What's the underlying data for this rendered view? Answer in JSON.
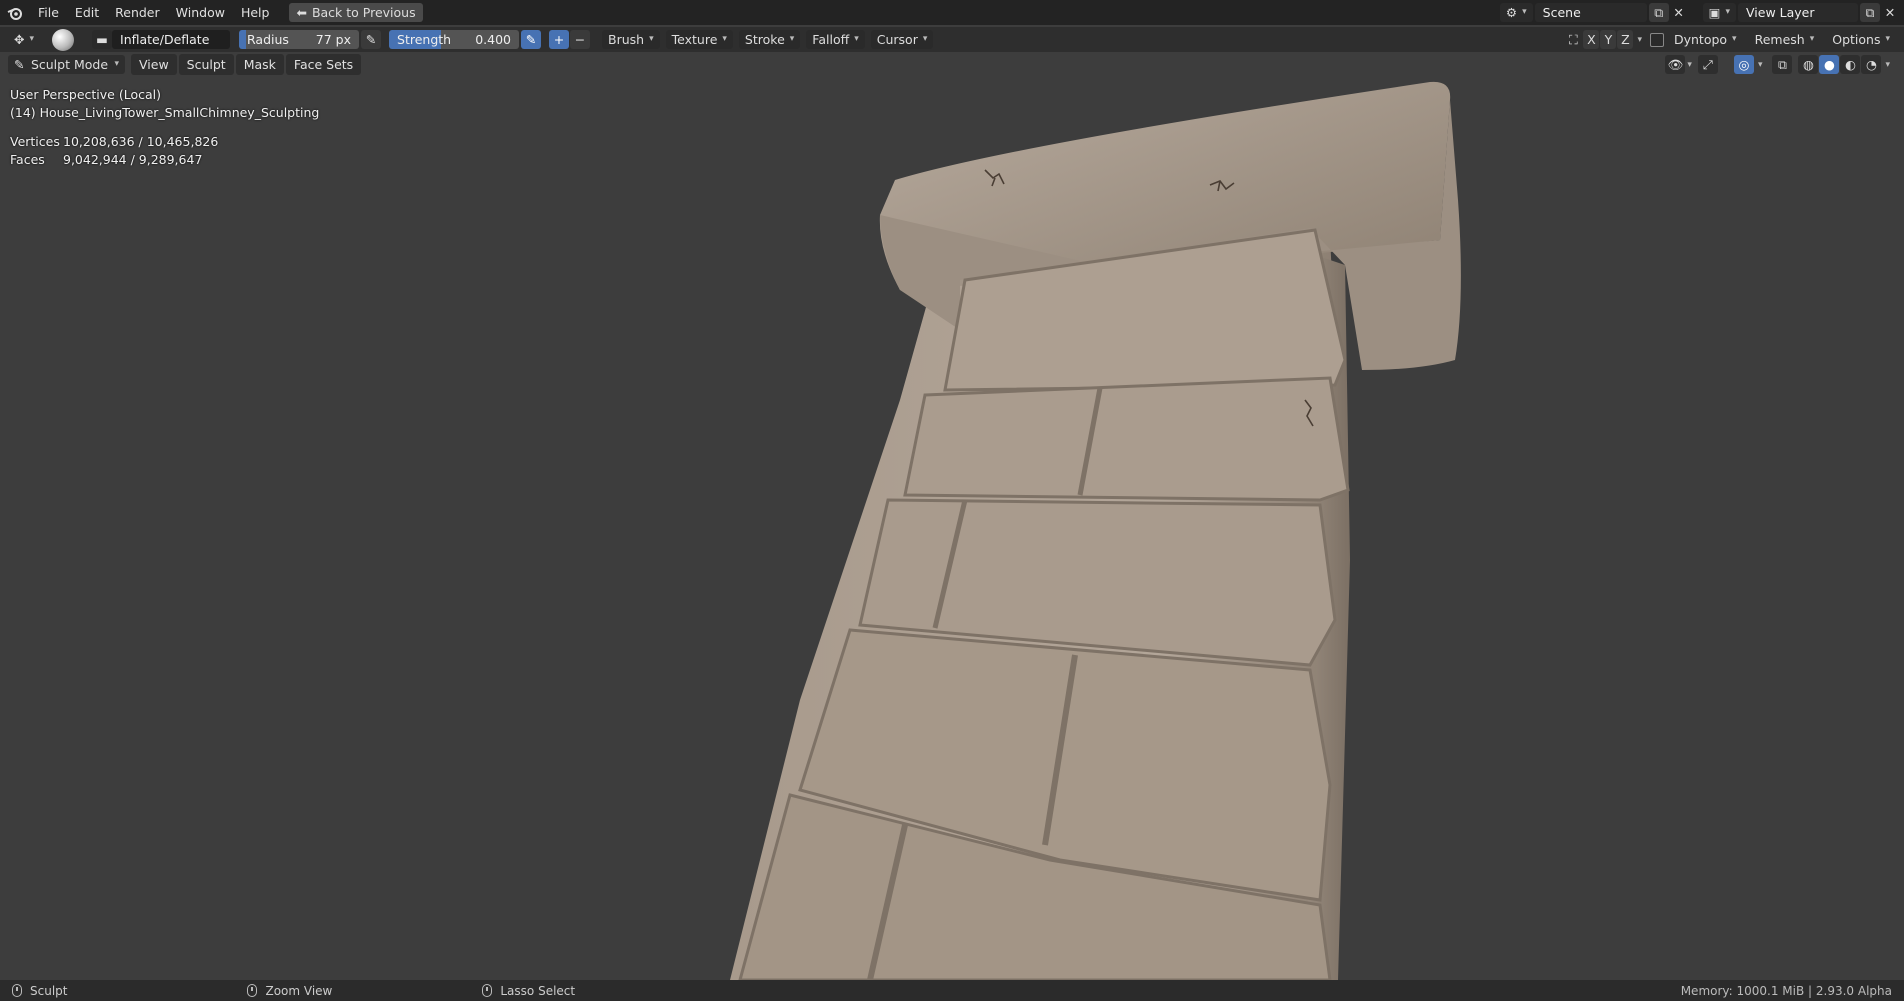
{
  "topbar": {
    "menu": [
      "File",
      "Edit",
      "Render",
      "Window",
      "Help"
    ],
    "back_label": "Back to Previous",
    "scene_value": "Scene",
    "view_layer_value": "View Layer"
  },
  "toolbar": {
    "brush_name": "Inflate/Deflate",
    "radius_label": "Radius",
    "radius_value": "77 px",
    "strength_label": "Strength",
    "strength_value": "0.400",
    "menus": [
      "Brush",
      "Texture",
      "Stroke",
      "Falloff",
      "Cursor"
    ],
    "axes": [
      "X",
      "Y",
      "Z"
    ],
    "dyntopo_label": "Dyntopo",
    "remesh_label": "Remesh",
    "options_label": "Options"
  },
  "header": {
    "mode_label": "Sculpt Mode",
    "menus": [
      "View",
      "Sculpt",
      "Mask",
      "Face Sets"
    ]
  },
  "overlay": {
    "perspective": "User Perspective (Local)",
    "object": "(14) House_LivingTower_SmallChimney_Sculpting",
    "vertices_label": "Vertices",
    "vertices_value": "10,208,636 / 10,465,826",
    "faces_label": "Faces",
    "faces_value": "9,042,944 / 9,289,647"
  },
  "statusbar": {
    "left": "Sculpt",
    "middle": "Zoom View",
    "right_action": "Lasso Select",
    "memory": "Memory: 1000.1 MiB | 2.93.0 Alpha"
  },
  "colors": {
    "accent": "#4772b3",
    "background": "#3d3d3d",
    "clay": "#a89a8c"
  }
}
